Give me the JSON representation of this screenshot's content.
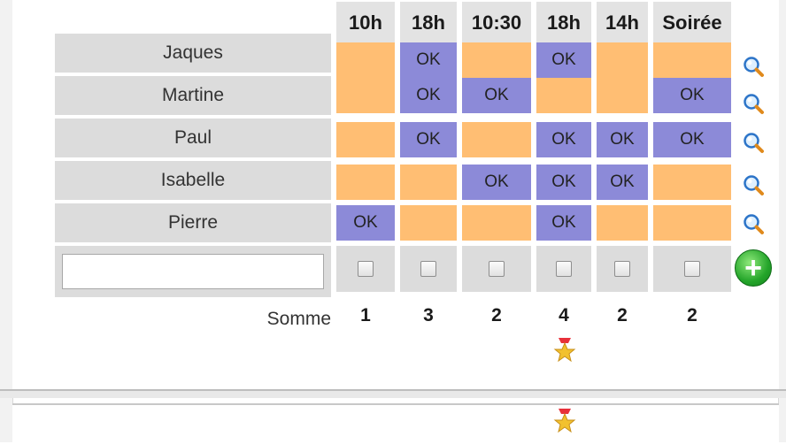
{
  "columns": [
    {
      "label": "10h"
    },
    {
      "label": "18h"
    },
    {
      "label": "10:30"
    },
    {
      "label": "18h"
    },
    {
      "label": "14h"
    },
    {
      "label": "Soirée"
    }
  ],
  "rows": [
    {
      "name": "Jaques",
      "cells": [
        "",
        "OK",
        "",
        "OK",
        "",
        ""
      ]
    },
    {
      "name": "Martine",
      "cells": [
        "",
        "OK",
        "OK",
        "",
        "",
        "OK"
      ]
    },
    {
      "name": "Paul",
      "cells": [
        "",
        "OK",
        "",
        "OK",
        "OK",
        "OK"
      ]
    },
    {
      "name": "Isabelle",
      "cells": [
        "",
        "",
        "OK",
        "OK",
        "OK",
        ""
      ]
    },
    {
      "name": "Pierre",
      "cells": [
        "OK",
        "",
        "",
        "OK",
        "",
        ""
      ]
    }
  ],
  "new_row": {
    "name_value": "",
    "name_placeholder": ""
  },
  "somme_label": "Somme",
  "sums": [
    "1",
    "3",
    "2",
    "4",
    "2",
    "2"
  ],
  "icons": {
    "row_action": "zoom-icon",
    "add": "add-icon",
    "best": "star-icon"
  },
  "colors": {
    "no": "#ffbe73",
    "ok": "#8c8ad8",
    "header": "#e3e3e3",
    "label": "#dcdcdc"
  }
}
